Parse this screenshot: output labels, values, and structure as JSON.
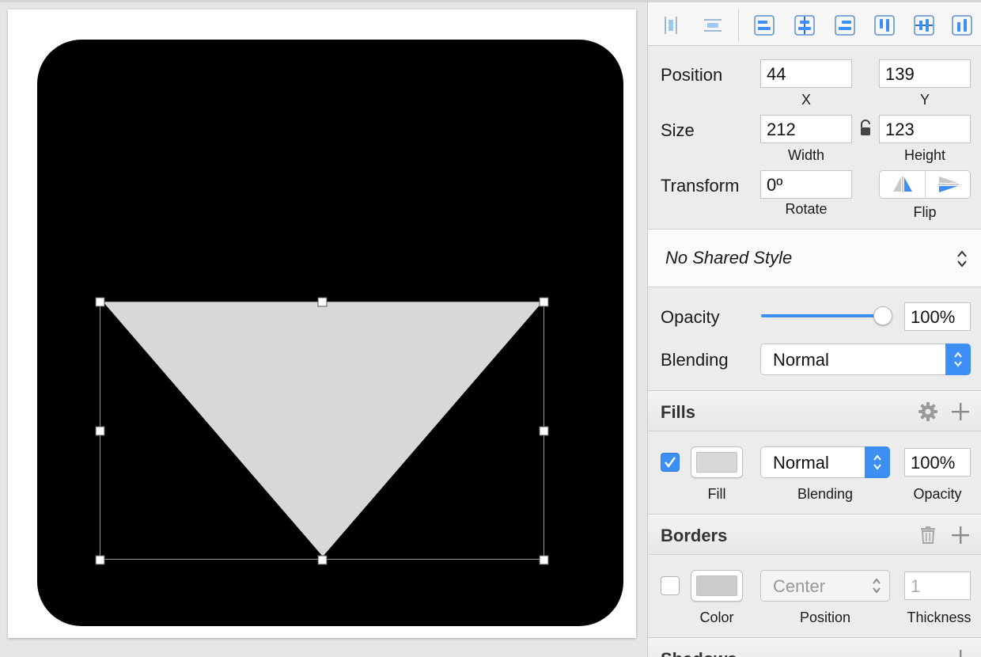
{
  "canvas": {
    "artboard_color": "#ffffff",
    "shape_background_color": "#000000",
    "triangle_fill": "#d8d8d8"
  },
  "toolbar": {
    "icons": [
      "distribute-horizontal-icon",
      "distribute-vertical-icon",
      "align-left-icon",
      "align-horizontal-center-icon",
      "align-right-icon",
      "align-top-icon",
      "align-vertical-center-icon",
      "align-bottom-icon"
    ]
  },
  "position": {
    "label": "Position",
    "x_value": "44",
    "x_label": "X",
    "y_value": "139",
    "y_label": "Y"
  },
  "size": {
    "label": "Size",
    "width_value": "212",
    "width_label": "Width",
    "height_value": "123",
    "height_label": "Height"
  },
  "transform": {
    "label": "Transform",
    "rotate_value": "0º",
    "rotate_label": "Rotate",
    "flip_label": "Flip"
  },
  "shared_style": {
    "value": "No Shared Style"
  },
  "opacity": {
    "label": "Opacity",
    "value": "100%",
    "level": 1.0
  },
  "blending": {
    "label": "Blending",
    "value": "Normal"
  },
  "fills": {
    "title": "Fills",
    "enabled": true,
    "color": "#d8d8d8",
    "blending_value": "Normal",
    "opacity_value": "100%",
    "col_fill": "Fill",
    "col_blending": "Blending",
    "col_opacity": "Opacity"
  },
  "borders": {
    "title": "Borders",
    "enabled": false,
    "color": "#cccccc",
    "position_value": "Center",
    "thickness_value": "1",
    "col_color": "Color",
    "col_position": "Position",
    "col_thickness": "Thickness"
  },
  "shadows": {
    "title": "Shadows"
  },
  "accent_color": "#3d8ff5"
}
